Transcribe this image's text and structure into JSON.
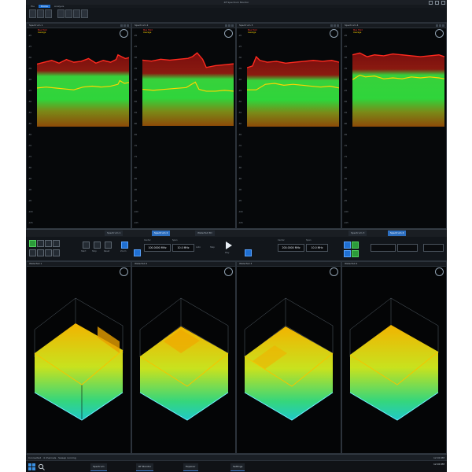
{
  "window": {
    "title": "RF Spectrum Monitor",
    "ribbon_tabs": [
      "File",
      "Home",
      "Analysis"
    ]
  },
  "top_panels": [
    {
      "title": "Spectrum 1",
      "legend": [
        "Max Hold",
        "Average"
      ]
    },
    {
      "title": "Spectrum 2",
      "legend": [
        "Max Hold",
        "Average"
      ]
    },
    {
      "title": "Spectrum 3",
      "legend": [
        "Max Hold",
        "Average"
      ]
    },
    {
      "title": "Spectrum 4",
      "legend": [
        "Max Hold",
        "Average"
      ]
    }
  ],
  "y_axis_ticks": [
    "-20",
    "-25",
    "-30",
    "-35",
    "-40",
    "-45",
    "-50",
    "-55",
    "-60",
    "-65",
    "-70",
    "-75",
    "-80",
    "-85",
    "-90",
    "-95",
    "-100",
    "-105"
  ],
  "middle": {
    "tabs": [
      "Spectrum 1",
      "Spectrum 2",
      "Waterfall 3D",
      "Spectrum 3",
      "Spectrum 4"
    ],
    "fields": [
      {
        "label": "Center",
        "value": "100.0000 MHz"
      },
      {
        "label": "Span",
        "value": "10.0 MHz"
      },
      {
        "label": "Center",
        "value": "200.0000 MHz"
      },
      {
        "label": "Span",
        "value": "10.0 MHz"
      }
    ],
    "buttons": [
      "Start",
      "Stop",
      "Reset",
      "Zoom",
      "Auto",
      "Step",
      "Play"
    ]
  },
  "bottom_panels": [
    {
      "title": "Waterfall 1"
    },
    {
      "title": "Waterfall 2"
    },
    {
      "title": "Waterfall 3"
    },
    {
      "title": "Waterfall 4"
    }
  ],
  "status": {
    "left": "Connected · 4 channels · Sweep running",
    "right": "12:00 PM"
  },
  "taskbar": {
    "items": [
      "Spectrum",
      "RF Monitor",
      "Explorer",
      "Settings"
    ],
    "time": "12:00 PM"
  },
  "colors": {
    "max_hold": "#ff3b30",
    "average": "#ffd400",
    "density_high": "#29e338",
    "density_low": "#a55a00",
    "accent": "#1e6fd0"
  },
  "icons": [
    "maximize-icon",
    "minimize-icon",
    "close-icon",
    "gauge-icon",
    "play-icon",
    "windows-icon",
    "search-icon"
  ]
}
